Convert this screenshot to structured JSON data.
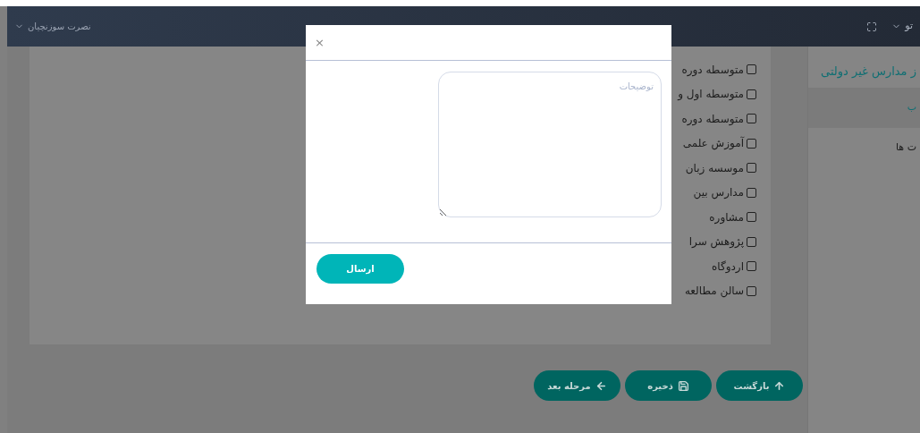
{
  "header": {
    "user": "نصرت سوزنچیان",
    "menu": "تو"
  },
  "sidebar": {
    "title": "ز مدارس غیر دولتی",
    "items": [
      {
        "label": "ب",
        "selected": true
      },
      {
        "label": "ت ها",
        "selected": false
      }
    ]
  },
  "options": [
    {
      "label": "متوسطه دوره",
      "checked": false
    },
    {
      "label": "متوسطه اول و",
      "checked": false
    },
    {
      "label": "متوسطه دوره",
      "checked": false
    },
    {
      "label": "آموزش علمی",
      "checked": false
    },
    {
      "label": "موسسه زبان",
      "checked": false
    },
    {
      "label": "مدارس بین",
      "checked": false
    },
    {
      "label": "مشاوره",
      "checked": false
    },
    {
      "label": "پژوهش سرا",
      "checked": false
    },
    {
      "label": "اردوگاه",
      "checked": false
    },
    {
      "label": "سالن مطالعه",
      "checked": false
    }
  ],
  "buttons": [
    {
      "label": "بازگشت",
      "kind": "up"
    },
    {
      "label": "ذخیره",
      "kind": "save"
    },
    {
      "label": "مرحله بعد",
      "kind": "left"
    }
  ],
  "modal": {
    "close": "×",
    "placeholder": "توضیحات",
    "submit": "ارسال"
  }
}
